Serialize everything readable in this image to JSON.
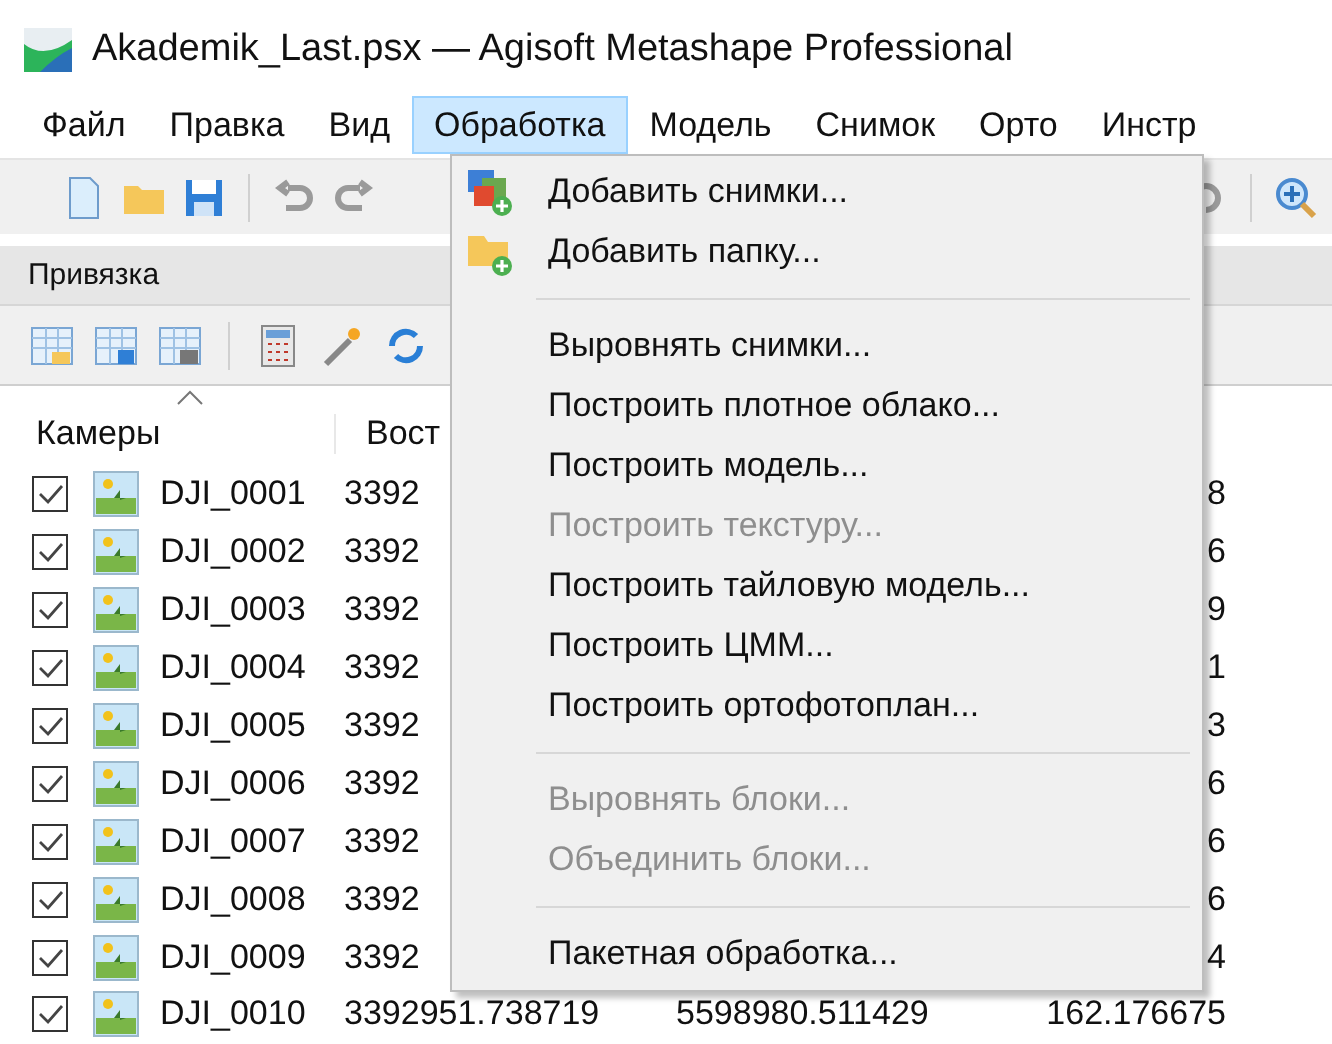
{
  "window": {
    "title": "Akademik_Last.psx — Agisoft Metashape Professional"
  },
  "menu_bar": [
    {
      "label": "Файл",
      "selected": false
    },
    {
      "label": "Правка",
      "selected": false
    },
    {
      "label": "Вид",
      "selected": false
    },
    {
      "label": "Обработка",
      "selected": true
    },
    {
      "label": "Модель",
      "selected": false
    },
    {
      "label": "Снимок",
      "selected": false
    },
    {
      "label": "Орто",
      "selected": false
    },
    {
      "label": "Инстр",
      "selected": false
    }
  ],
  "panel": {
    "title": "Привязка"
  },
  "table": {
    "columns": [
      "Камеры",
      "Вост"
    ],
    "rows": [
      {
        "checked": true,
        "name": "DJI_0001",
        "column_2": "3392",
        "column_4": "8"
      },
      {
        "checked": true,
        "name": "DJI_0002",
        "column_2": "3392",
        "column_4": "6"
      },
      {
        "checked": true,
        "name": "DJI_0003",
        "column_2": "3392",
        "column_4": "9"
      },
      {
        "checked": true,
        "name": "DJI_0004",
        "column_2": "3392",
        "column_4": "1"
      },
      {
        "checked": true,
        "name": "DJI_0005",
        "column_2": "3392",
        "column_4": "3"
      },
      {
        "checked": true,
        "name": "DJI_0006",
        "column_2": "3392",
        "column_4": "6"
      },
      {
        "checked": true,
        "name": "DJI_0007",
        "column_2": "3392",
        "column_4": "6"
      },
      {
        "checked": true,
        "name": "DJI_0008",
        "column_2": "3392",
        "column_4": "6"
      },
      {
        "checked": true,
        "name": "DJI_0009",
        "column_2": "3392",
        "column_4": "4"
      },
      {
        "checked": true,
        "name": "DJI_0010",
        "column_2": "3392951.738719",
        "column_3": "5598980.511429",
        "column_4": "162.176675"
      }
    ]
  },
  "dropdown_menu": [
    {
      "kind": "item",
      "label": "Добавить снимки...",
      "disabled": false
    },
    {
      "kind": "item",
      "label": "Добавить папку...",
      "disabled": false
    },
    {
      "kind": "separator"
    },
    {
      "kind": "item",
      "label": "Выровнять снимки...",
      "disabled": false
    },
    {
      "kind": "item",
      "label": "Построить плотное облако...",
      "disabled": false
    },
    {
      "kind": "item",
      "label": "Построить модель...",
      "disabled": false
    },
    {
      "kind": "item",
      "label": "Построить текстуру...",
      "disabled": true
    },
    {
      "kind": "item",
      "label": "Построить тайловую модель...",
      "disabled": false
    },
    {
      "kind": "item",
      "label": "Построить ЦММ...",
      "disabled": false
    },
    {
      "kind": "item",
      "label": "Построить ортофотоплан...",
      "disabled": false
    },
    {
      "kind": "separator"
    },
    {
      "kind": "item",
      "label": "Выровнять блоки...",
      "disabled": true
    },
    {
      "kind": "item",
      "label": "Объединить блоки...",
      "disabled": true
    },
    {
      "kind": "separator"
    },
    {
      "kind": "item",
      "label": "Пакетная обработка...",
      "disabled": false
    }
  ]
}
